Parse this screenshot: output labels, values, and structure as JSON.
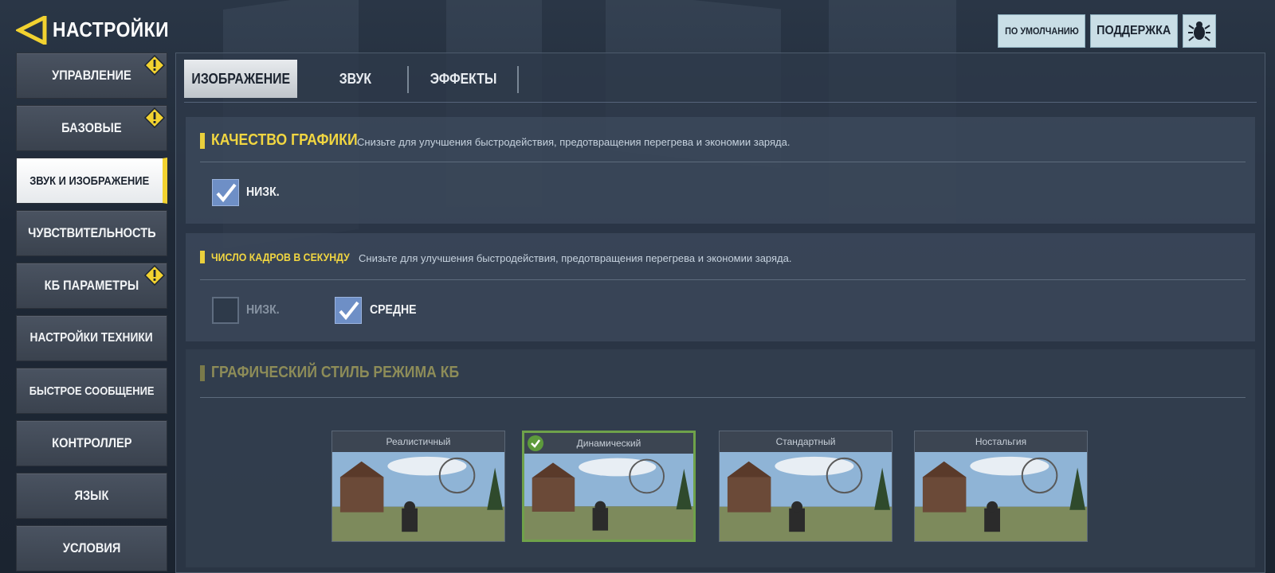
{
  "header": {
    "title": "НАСТРОЙКИ",
    "buttons": {
      "default": "ПО УМОЛЧАНИЮ",
      "support": "ПОДДЕРЖКА",
      "bug_icon": "bug-icon"
    }
  },
  "sidebar": {
    "items": [
      {
        "label": "УПРАВЛЕНИЕ",
        "warning": true
      },
      {
        "label": "БАЗОВЫЕ",
        "warning": true
      },
      {
        "label": "ЗВУК И ИЗОБРАЖЕНИЕ",
        "active": true
      },
      {
        "label": "ЧУВСТВИТЕЛЬНОСТЬ"
      },
      {
        "label": "КБ ПАРАМЕТРЫ",
        "warning": true
      },
      {
        "label": "НАСТРОЙКИ ТЕХНИКИ"
      },
      {
        "label": "БЫСТРОЕ СООБЩЕНИЕ"
      },
      {
        "label": "КОНТРОЛЛЕР"
      },
      {
        "label": "ЯЗЫК"
      },
      {
        "label": "УСЛОВИЯ"
      }
    ]
  },
  "tabs": [
    {
      "label": "ИЗОБРАЖЕНИЕ",
      "active": true
    },
    {
      "label": "ЗВУК"
    },
    {
      "label": "ЭФФЕКТЫ"
    }
  ],
  "sections": {
    "graphics_quality": {
      "title": "КАЧЕСТВО ГРАФИКИ",
      "description": "Снизьте для улучшения быстродействия, предотвращения перегрева и экономии заряда.",
      "options": [
        {
          "label": "НИЗК.",
          "checked": true
        }
      ]
    },
    "frame_rate": {
      "title": "ЧИСЛО КАДРОВ В СЕКУНДУ",
      "description": "Снизьте для улучшения быстродействия, предотвращения перегрева и экономии заряда.",
      "options": [
        {
          "label": "НИЗК.",
          "checked": false
        },
        {
          "label": "СРЕДНЕ",
          "checked": true
        }
      ]
    },
    "br_style": {
      "title": "ГРАФИЧЕСКИЙ СТИЛЬ РЕЖИМА КБ",
      "styles": [
        {
          "name": "Реалистичный",
          "selected": false
        },
        {
          "name": "Динамический",
          "selected": true
        },
        {
          "name": "Стандартный",
          "selected": false
        },
        {
          "name": "Ностальгия",
          "selected": false
        }
      ]
    }
  },
  "colors": {
    "accent_yellow": "#f1d641",
    "checkbox_blue": "#6e8fc6",
    "selected_green": "#6fa24a"
  }
}
